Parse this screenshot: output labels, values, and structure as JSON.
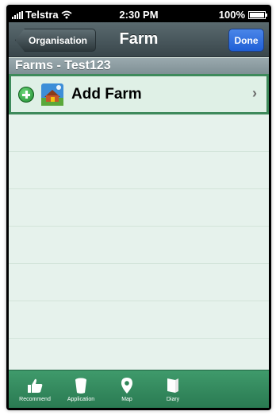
{
  "status_bar": {
    "carrier": "Telstra",
    "time": "2:30 PM",
    "battery": "100%",
    "battery_level": 1.0
  },
  "nav": {
    "back_label": "Organisation",
    "title": "Farm",
    "done_label": "Done"
  },
  "section": {
    "header": "Farms - Test123"
  },
  "list": {
    "add_label": "Add Farm",
    "chevron": "›",
    "empty_rows": 7
  },
  "tabs": [
    {
      "label": "Recommend",
      "icon": "thumbs-up-icon"
    },
    {
      "label": "Application",
      "icon": "bucket-icon"
    },
    {
      "label": "Map",
      "icon": "map-pin-icon"
    },
    {
      "label": "Diary",
      "icon": "book-icon"
    }
  ],
  "colors": {
    "nav": "#39464b",
    "selected_border": "#3e8a5b",
    "tab_bar": "#2f8558",
    "done": "#1f5fd6"
  }
}
